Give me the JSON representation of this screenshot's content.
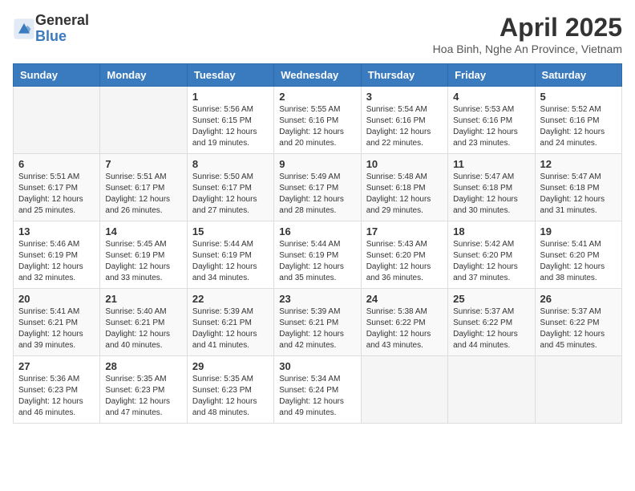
{
  "header": {
    "logo_general": "General",
    "logo_blue": "Blue",
    "title": "April 2025",
    "subtitle": "Hoa Binh, Nghe An Province, Vietnam"
  },
  "calendar": {
    "days_of_week": [
      "Sunday",
      "Monday",
      "Tuesday",
      "Wednesday",
      "Thursday",
      "Friday",
      "Saturday"
    ],
    "weeks": [
      [
        {
          "day": "",
          "info": ""
        },
        {
          "day": "",
          "info": ""
        },
        {
          "day": "1",
          "info": "Sunrise: 5:56 AM\nSunset: 6:15 PM\nDaylight: 12 hours and 19 minutes."
        },
        {
          "day": "2",
          "info": "Sunrise: 5:55 AM\nSunset: 6:16 PM\nDaylight: 12 hours and 20 minutes."
        },
        {
          "day": "3",
          "info": "Sunrise: 5:54 AM\nSunset: 6:16 PM\nDaylight: 12 hours and 22 minutes."
        },
        {
          "day": "4",
          "info": "Sunrise: 5:53 AM\nSunset: 6:16 PM\nDaylight: 12 hours and 23 minutes."
        },
        {
          "day": "5",
          "info": "Sunrise: 5:52 AM\nSunset: 6:16 PM\nDaylight: 12 hours and 24 minutes."
        }
      ],
      [
        {
          "day": "6",
          "info": "Sunrise: 5:51 AM\nSunset: 6:17 PM\nDaylight: 12 hours and 25 minutes."
        },
        {
          "day": "7",
          "info": "Sunrise: 5:51 AM\nSunset: 6:17 PM\nDaylight: 12 hours and 26 minutes."
        },
        {
          "day": "8",
          "info": "Sunrise: 5:50 AM\nSunset: 6:17 PM\nDaylight: 12 hours and 27 minutes."
        },
        {
          "day": "9",
          "info": "Sunrise: 5:49 AM\nSunset: 6:17 PM\nDaylight: 12 hours and 28 minutes."
        },
        {
          "day": "10",
          "info": "Sunrise: 5:48 AM\nSunset: 6:18 PM\nDaylight: 12 hours and 29 minutes."
        },
        {
          "day": "11",
          "info": "Sunrise: 5:47 AM\nSunset: 6:18 PM\nDaylight: 12 hours and 30 minutes."
        },
        {
          "day": "12",
          "info": "Sunrise: 5:47 AM\nSunset: 6:18 PM\nDaylight: 12 hours and 31 minutes."
        }
      ],
      [
        {
          "day": "13",
          "info": "Sunrise: 5:46 AM\nSunset: 6:19 PM\nDaylight: 12 hours and 32 minutes."
        },
        {
          "day": "14",
          "info": "Sunrise: 5:45 AM\nSunset: 6:19 PM\nDaylight: 12 hours and 33 minutes."
        },
        {
          "day": "15",
          "info": "Sunrise: 5:44 AM\nSunset: 6:19 PM\nDaylight: 12 hours and 34 minutes."
        },
        {
          "day": "16",
          "info": "Sunrise: 5:44 AM\nSunset: 6:19 PM\nDaylight: 12 hours and 35 minutes."
        },
        {
          "day": "17",
          "info": "Sunrise: 5:43 AM\nSunset: 6:20 PM\nDaylight: 12 hours and 36 minutes."
        },
        {
          "day": "18",
          "info": "Sunrise: 5:42 AM\nSunset: 6:20 PM\nDaylight: 12 hours and 37 minutes."
        },
        {
          "day": "19",
          "info": "Sunrise: 5:41 AM\nSunset: 6:20 PM\nDaylight: 12 hours and 38 minutes."
        }
      ],
      [
        {
          "day": "20",
          "info": "Sunrise: 5:41 AM\nSunset: 6:21 PM\nDaylight: 12 hours and 39 minutes."
        },
        {
          "day": "21",
          "info": "Sunrise: 5:40 AM\nSunset: 6:21 PM\nDaylight: 12 hours and 40 minutes."
        },
        {
          "day": "22",
          "info": "Sunrise: 5:39 AM\nSunset: 6:21 PM\nDaylight: 12 hours and 41 minutes."
        },
        {
          "day": "23",
          "info": "Sunrise: 5:39 AM\nSunset: 6:21 PM\nDaylight: 12 hours and 42 minutes."
        },
        {
          "day": "24",
          "info": "Sunrise: 5:38 AM\nSunset: 6:22 PM\nDaylight: 12 hours and 43 minutes."
        },
        {
          "day": "25",
          "info": "Sunrise: 5:37 AM\nSunset: 6:22 PM\nDaylight: 12 hours and 44 minutes."
        },
        {
          "day": "26",
          "info": "Sunrise: 5:37 AM\nSunset: 6:22 PM\nDaylight: 12 hours and 45 minutes."
        }
      ],
      [
        {
          "day": "27",
          "info": "Sunrise: 5:36 AM\nSunset: 6:23 PM\nDaylight: 12 hours and 46 minutes."
        },
        {
          "day": "28",
          "info": "Sunrise: 5:35 AM\nSunset: 6:23 PM\nDaylight: 12 hours and 47 minutes."
        },
        {
          "day": "29",
          "info": "Sunrise: 5:35 AM\nSunset: 6:23 PM\nDaylight: 12 hours and 48 minutes."
        },
        {
          "day": "30",
          "info": "Sunrise: 5:34 AM\nSunset: 6:24 PM\nDaylight: 12 hours and 49 minutes."
        },
        {
          "day": "",
          "info": ""
        },
        {
          "day": "",
          "info": ""
        },
        {
          "day": "",
          "info": ""
        }
      ]
    ]
  }
}
